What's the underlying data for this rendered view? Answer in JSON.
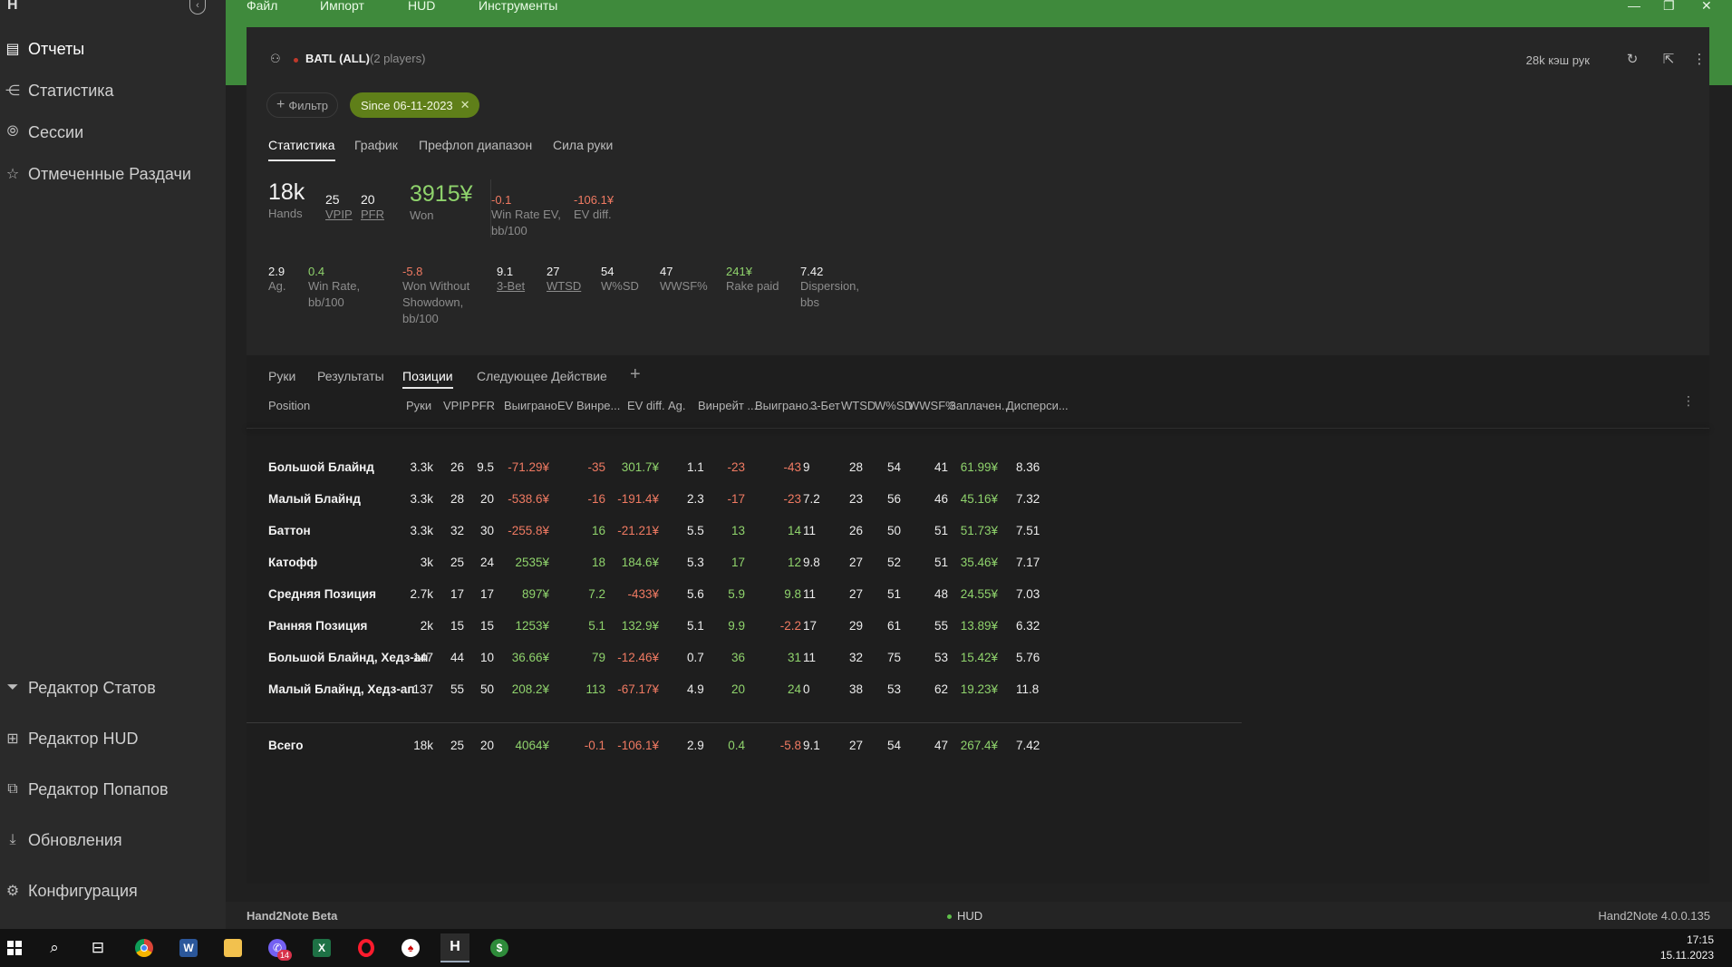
{
  "app": {
    "logo": "H",
    "collapse_icon": "chevron-left-icon"
  },
  "sidebar": {
    "top_items": [
      {
        "label": "Отчеты",
        "icon": "report-icon",
        "active": true
      },
      {
        "label": "Статистика",
        "icon": "share-nodes-icon"
      },
      {
        "label": "Сессии",
        "icon": "broadcast-icon"
      },
      {
        "label": "Отмеченные Раздачи",
        "icon": "star-icon"
      }
    ],
    "bottom_items": [
      {
        "label": "Редактор Статов",
        "icon": "filter-icon"
      },
      {
        "label": "Редактор HUD",
        "icon": "hud-grid-icon"
      },
      {
        "label": "Редактор Попапов",
        "icon": "popup-icon"
      },
      {
        "label": "Обновления",
        "icon": "download-icon"
      },
      {
        "label": "Конфигурация",
        "icon": "gear-icon"
      }
    ]
  },
  "menu": [
    "Файл",
    "Импорт",
    "HUD",
    "Инструменты"
  ],
  "header": {
    "player": "BATL (ALL)",
    "players_count": "(2 players)",
    "cash": "28k кэш рук",
    "filter_button": "Фильтр",
    "since_chip": "Since 06-11-2023"
  },
  "tabs_main": [
    "Статистика",
    "График",
    "Префлоп диапазон",
    "Сила руки"
  ],
  "stats_row1": {
    "hands": {
      "v": "18k",
      "l": "Hands"
    },
    "vpip": {
      "v": "25",
      "l": "VPIP"
    },
    "pfr": {
      "v": "20",
      "l": "PFR"
    },
    "won": {
      "v": "3915¥",
      "l": "Won"
    },
    "winrate_ev": {
      "v": "-0.1",
      "l1": "Win Rate EV,",
      "l2": "bb/100"
    },
    "ev_diff": {
      "v": "-106.1¥",
      "l": "EV diff."
    }
  },
  "stats_row2": [
    {
      "v": "2.9",
      "l1": "Ag.",
      "l2": "",
      "l3": "",
      "color": "white"
    },
    {
      "v": "0.4",
      "l1": "Win Rate,",
      "l2": "bb/100",
      "l3": "",
      "color": "green"
    },
    {
      "v": "-5.8",
      "l1": "Won Without",
      "l2": "Showdown,",
      "l3": "bb/100",
      "color": "red"
    },
    {
      "v": "9.1",
      "l1": "3-Bet",
      "l2": "",
      "l3": "",
      "color": "white",
      "underline": true
    },
    {
      "v": "27",
      "l1": "WTSD",
      "l2": "",
      "l3": "",
      "color": "white",
      "underline": true
    },
    {
      "v": "54",
      "l1": "W%SD",
      "l2": "",
      "l3": "",
      "color": "white"
    },
    {
      "v": "47",
      "l1": "WWSF%",
      "l2": "",
      "l3": "",
      "color": "white"
    },
    {
      "v": "241¥",
      "l1": "Rake paid",
      "l2": "",
      "l3": "",
      "color": "green"
    },
    {
      "v": "7.42",
      "l1": "Dispersion,",
      "l2": "bbs",
      "l3": "",
      "color": "white"
    }
  ],
  "tabs_table": [
    "Руки",
    "Результаты",
    "Позиции",
    "Следующее Действие"
  ],
  "columns": [
    "Position",
    "Руки",
    "VPIP",
    "PFR",
    "Выиграно",
    "EV Винре...",
    "EV diff.",
    "Ag.",
    "Винрейт ...",
    "Выиграно...",
    "3-Бет",
    "WTSD",
    "W%SD",
    "WWSF%",
    "Заплачен...",
    "Дисперси..."
  ],
  "rows": [
    [
      "Большой Блайнд",
      "3.3k",
      "26",
      "9.5",
      "-71.29¥",
      "-35",
      "301.7¥",
      "1.1",
      "-23",
      "-43",
      "9",
      "28",
      "54",
      "41",
      "61.99¥",
      "8.36"
    ],
    [
      "Малый Блайнд",
      "3.3k",
      "28",
      "20",
      "-538.6¥",
      "-16",
      "-191.4¥",
      "2.3",
      "-17",
      "-23",
      "7.2",
      "23",
      "56",
      "46",
      "45.16¥",
      "7.32"
    ],
    [
      "Баттон",
      "3.3k",
      "32",
      "30",
      "-255.8¥",
      "16",
      "-21.21¥",
      "5.5",
      "13",
      "14",
      "11",
      "26",
      "50",
      "51",
      "51.73¥",
      "7.51"
    ],
    [
      "Катофф",
      "3k",
      "25",
      "24",
      "2535¥",
      "18",
      "184.6¥",
      "5.3",
      "17",
      "12",
      "9.8",
      "27",
      "52",
      "51",
      "35.46¥",
      "7.17"
    ],
    [
      "Средняя Позиция",
      "2.7k",
      "17",
      "17",
      "897¥",
      "7.2",
      "-433¥",
      "5.6",
      "5.9",
      "9.8",
      "11",
      "27",
      "51",
      "48",
      "24.55¥",
      "7.03"
    ],
    [
      "Ранняя Позиция",
      "2k",
      "15",
      "15",
      "1253¥",
      "5.1",
      "132.9¥",
      "5.1",
      "9.9",
      "-2.2",
      "17",
      "29",
      "61",
      "55",
      "13.89¥",
      "6.32"
    ],
    [
      "Большой Блайнд, Хедз-ап",
      "147",
      "44",
      "10",
      "36.66¥",
      "79",
      "-12.46¥",
      "0.7",
      "36",
      "31",
      "11",
      "32",
      "75",
      "53",
      "15.42¥",
      "5.76"
    ],
    [
      "Малый Блайнд, Хедз-ап",
      "137",
      "55",
      "50",
      "208.2¥",
      "113",
      "-67.17¥",
      "4.9",
      "20",
      "24",
      "0",
      "38",
      "53",
      "62",
      "19.23¥",
      "11.8"
    ]
  ],
  "total": [
    "Всего",
    "18k",
    "25",
    "20",
    "4064¥",
    "-0.1",
    "-106.1¥",
    "2.9",
    "0.4",
    "-5.8",
    "9.1",
    "27",
    "54",
    "47",
    "267.4¥",
    "7.42"
  ],
  "statusbar": {
    "left": "Hand2Note Beta",
    "mid": "HUD",
    "right": "Hand2Note 4.0.0.135"
  },
  "taskbar": {
    "time": "17:15",
    "date": "15.11.2023",
    "viber_badge": "14"
  },
  "colors": {
    "accent_green": "#3f8a3c",
    "chip": "#5f7f19",
    "positive": "#8fd36c",
    "negative": "#f07a62"
  }
}
